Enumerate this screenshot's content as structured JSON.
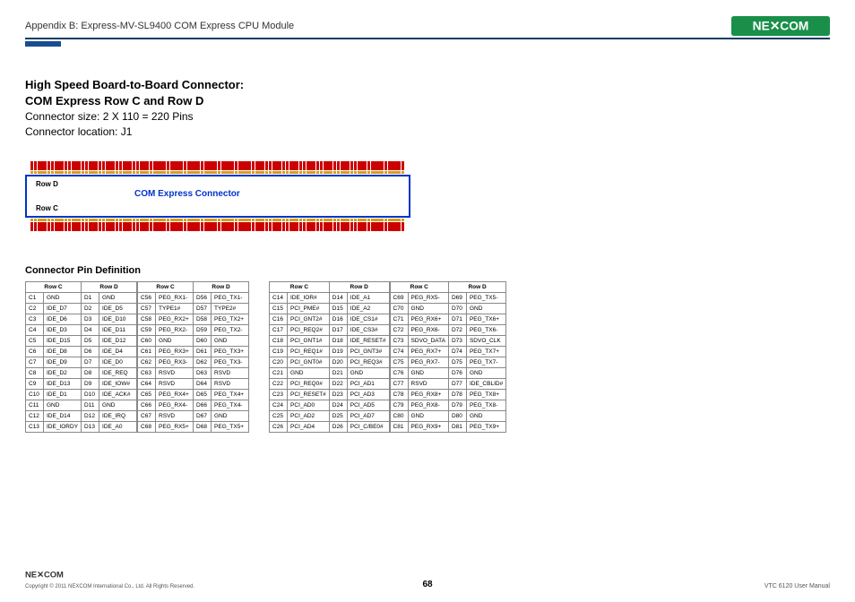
{
  "header": {
    "appendix": "Appendix B: Express-MV-SL9400 COM Express CPU Module",
    "brand": "NEXCOM"
  },
  "intro": {
    "title1": "High Speed Board-to-Board Connector:",
    "title2": "COM Express Row C and Row D",
    "line1": "Connector size: 2 X 110 = 220 Pins",
    "line2": "Connector location: J1"
  },
  "diagram": {
    "rowd": "Row D",
    "rowc": "Row C",
    "label": "COM Express Connector"
  },
  "pin_def_title": "Connector Pin Definition",
  "th": {
    "rowc": "Row C",
    "rowd": "Row D"
  },
  "t1": [
    [
      "C1",
      "GND",
      "D1",
      "GND"
    ],
    [
      "C2",
      "IDE_D7",
      "D2",
      "IDE_D5"
    ],
    [
      "C3",
      "IDE_D6",
      "D3",
      "IDE_D10"
    ],
    [
      "C4",
      "IDE_D3",
      "D4",
      "IDE_D11"
    ],
    [
      "C5",
      "IDE_D15",
      "D5",
      "IDE_D12"
    ],
    [
      "C6",
      "IDE_D8",
      "D6",
      "IDE_D4"
    ],
    [
      "C7",
      "IDE_D9",
      "D7",
      "IDE_D0"
    ],
    [
      "C8",
      "IDE_D2",
      "D8",
      "IDE_REQ"
    ],
    [
      "C9",
      "IDE_D13",
      "D9",
      "IDE_IOW#"
    ],
    [
      "C10",
      "IDE_D1",
      "D10",
      "IDE_ACK#"
    ],
    [
      "C11",
      "GND",
      "D11",
      "GND"
    ],
    [
      "C12",
      "IDE_D14",
      "D12",
      "IDE_IRQ"
    ],
    [
      "C13",
      "IDE_IORDY",
      "D13",
      "IDE_A0"
    ]
  ],
  "t2": [
    [
      "C56",
      "PEG_RX1-",
      "D56",
      "PEG_TX1-"
    ],
    [
      "C57",
      "TYPE1#",
      "D57",
      "TYPE2#"
    ],
    [
      "C58",
      "PEG_RX2+",
      "D58",
      "PEG_TX2+"
    ],
    [
      "C59",
      "PEG_RX2-",
      "D59",
      "PEG_TX2-"
    ],
    [
      "C60",
      "GND",
      "D60",
      "GND"
    ],
    [
      "C61",
      "PEG_RX3+",
      "D61",
      "PEG_TX3+"
    ],
    [
      "C62",
      "PEG_RX3-",
      "D62",
      "PEG_TX3-"
    ],
    [
      "C63",
      "RSVD",
      "D63",
      "RSVD"
    ],
    [
      "C64",
      "RSVD",
      "D64",
      "RSVD"
    ],
    [
      "C65",
      "PEG_RX4+",
      "D65",
      "PEG_TX4+"
    ],
    [
      "C66",
      "PEG_RX4-",
      "D66",
      "PEG_TX4-"
    ],
    [
      "C67",
      "RSVD",
      "D67",
      "GND"
    ],
    [
      "C68",
      "PEG_RX5+",
      "D68",
      "PEG_TX5+"
    ]
  ],
  "t3": [
    [
      "C14",
      "IDE_IOR#",
      "D14",
      "IDE_A1"
    ],
    [
      "C15",
      "PCI_PME#",
      "D15",
      "IDE_A2"
    ],
    [
      "C16",
      "PCI_GNT2#",
      "D16",
      "IDE_CS1#"
    ],
    [
      "C17",
      "PCI_REQ2#",
      "D17",
      "IDE_CS3#"
    ],
    [
      "C18",
      "PCI_GNT1#",
      "D18",
      "IDE_RESET#"
    ],
    [
      "C19",
      "PCI_REQ1#",
      "D19",
      "PCI_GNT3#"
    ],
    [
      "C20",
      "PCI_GNT0#",
      "D20",
      "PCI_REQ3#"
    ],
    [
      "C21",
      "GND",
      "D21",
      "GND"
    ],
    [
      "C22",
      "PCI_REQ0#",
      "D22",
      "PCI_AD1"
    ],
    [
      "C23",
      "PCI_RESET#",
      "D23",
      "PCI_AD3"
    ],
    [
      "C24",
      "PCI_AD0",
      "D24",
      "PCI_AD5"
    ],
    [
      "C25",
      "PCI_AD2",
      "D25",
      "PCI_AD7"
    ],
    [
      "C26",
      "PCI_AD4",
      "D26",
      "PCI_C/BE0#"
    ]
  ],
  "t4": [
    [
      "C69",
      "PEG_RX5-",
      "D69",
      "PEG_TX5-"
    ],
    [
      "C70",
      "GND",
      "D70",
      "GND"
    ],
    [
      "C71",
      "PEG_RX6+",
      "D71",
      "PEG_TX6+"
    ],
    [
      "C72",
      "PEG_RX6-",
      "D72",
      "PEG_TX6-"
    ],
    [
      "C73",
      "SDVO_DATA",
      "D73",
      "SDVO_CLK"
    ],
    [
      "C74",
      "PEG_RX7+",
      "D74",
      "PEG_TX7+"
    ],
    [
      "C75",
      "PEG_RX7-",
      "D75",
      "PEG_TX7-"
    ],
    [
      "C76",
      "GND",
      "D76",
      "GND"
    ],
    [
      "C77",
      "RSVD",
      "D77",
      "IDE_CBLID#"
    ],
    [
      "C78",
      "PEG_RX8+",
      "D78",
      "PEG_TX8+"
    ],
    [
      "C79",
      "PEG_RX8-",
      "D79",
      "PEG_TX8-"
    ],
    [
      "C80",
      "GND",
      "D80",
      "GND"
    ],
    [
      "C81",
      "PEG_RX9+",
      "D81",
      "PEG_TX9+"
    ]
  ],
  "footer": {
    "copyright": "Copyright © 2011 NEXCOM International Co., Ltd. All Rights Reserved.",
    "page": "68",
    "manual": "VTC 6120 User Manual"
  }
}
